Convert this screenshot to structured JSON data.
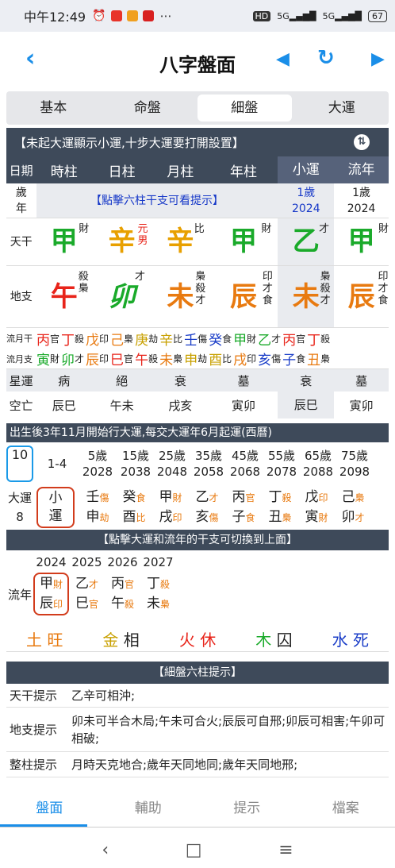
{
  "status": {
    "time": "中午12:49",
    "battery": "67",
    "signal1": "5G",
    "signal2": "5G",
    "hd": "HD"
  },
  "appbar": {
    "title": "八字盤面",
    "back": "‹",
    "prev": "◀",
    "refresh": "↻",
    "next": "▶"
  },
  "tabs": [
    "基本",
    "命盤",
    "細盤",
    "大運"
  ],
  "active_tab": "細盤",
  "header_note": "【未起大運顯示小運,十步大運要打開設置】",
  "columns": [
    "日期",
    "時柱",
    "日柱",
    "月柱",
    "年柱",
    "小運",
    "流年"
  ],
  "age_row": {
    "label": "歲年",
    "hint": "【點擊六柱干支可看提示】",
    "xiaoyun_age": "1歲",
    "xiaoyun_year": "2024",
    "liunian_age": "1歲",
    "liunian_year": "2024"
  },
  "stems": {
    "label": "天干",
    "items": [
      {
        "char": "甲",
        "god": "財"
      },
      {
        "char": "辛",
        "god": "元男"
      },
      {
        "char": "辛",
        "god": "比"
      },
      {
        "char": "甲",
        "god": "財"
      },
      {
        "char": "乙",
        "god": "才"
      },
      {
        "char": "甲",
        "god": "財"
      }
    ]
  },
  "branches": {
    "label": "地支",
    "items": [
      {
        "char": "午",
        "god": "殺梟"
      },
      {
        "char": "卯",
        "god": "才"
      },
      {
        "char": "未",
        "god": "梟殺才"
      },
      {
        "char": "辰",
        "god": "印才食"
      },
      {
        "char": "未",
        "god": "梟殺才"
      },
      {
        "char": "辰",
        "god": "印才食"
      }
    ]
  },
  "liu_stems": {
    "label": "流月干",
    "text": [
      [
        "丙",
        "官"
      ],
      [
        "丁",
        "殺"
      ],
      [
        "戊",
        "印"
      ],
      [
        "己",
        "梟"
      ],
      [
        "庚",
        "劫"
      ],
      [
        "辛",
        "比"
      ],
      [
        "壬",
        "傷"
      ],
      [
        "癸",
        "食"
      ],
      [
        "甲",
        "財"
      ],
      [
        "乙",
        "才"
      ],
      [
        "丙",
        "官"
      ],
      [
        "丁",
        "殺"
      ]
    ]
  },
  "liu_branches": {
    "label": "流月支",
    "text": [
      [
        "寅",
        "財"
      ],
      [
        "卯",
        "才"
      ],
      [
        "辰",
        "印"
      ],
      [
        "巳",
        "官"
      ],
      [
        "午",
        "殺"
      ],
      [
        "未",
        "梟"
      ],
      [
        "申",
        "劫"
      ],
      [
        "酉",
        "比"
      ],
      [
        "戌",
        "印"
      ],
      [
        "亥",
        "傷"
      ],
      [
        "子",
        "食"
      ],
      [
        "丑",
        "梟"
      ]
    ]
  },
  "xingyun": {
    "label": "星運",
    "values": [
      "病",
      "絕",
      "衰",
      "墓",
      "衰",
      "墓"
    ]
  },
  "kongwang": {
    "label": "空亡",
    "values": [
      "辰巳",
      "午未",
      "戌亥",
      "寅卯",
      "辰巳",
      "寅卯"
    ]
  },
  "dayun_note": "出生後3年11月開始行大運,每交大運年6月起運(西曆)",
  "dayun_ages": [
    {
      "age": "10",
      "year": ""
    },
    {
      "age": "1-4",
      "year": ""
    },
    {
      "age": "5歲",
      "year": "2028"
    },
    {
      "age": "15歲",
      "year": "2038"
    },
    {
      "age": "25歲",
      "year": "2048"
    },
    {
      "age": "35歲",
      "year": "2058"
    },
    {
      "age": "45歲",
      "year": "2068"
    },
    {
      "age": "55歲",
      "year": "2078"
    },
    {
      "age": "65歲",
      "year": "2088"
    },
    {
      "age": "75歲",
      "year": "2098"
    }
  ],
  "dayun_label": "大運",
  "dayun_num": "8",
  "dayun_small": "小運",
  "dayun_pillars": [
    {
      "s": "壬",
      "sg": "傷",
      "b": "申",
      "bg": "劫"
    },
    {
      "s": "癸",
      "sg": "食",
      "b": "酉",
      "bg": "比"
    },
    {
      "s": "甲",
      "sg": "財",
      "b": "戌",
      "bg": "印"
    },
    {
      "s": "乙",
      "sg": "才",
      "b": "亥",
      "bg": "傷"
    },
    {
      "s": "丙",
      "sg": "官",
      "b": "子",
      "bg": "食"
    },
    {
      "s": "丁",
      "sg": "殺",
      "b": "丑",
      "bg": "梟"
    },
    {
      "s": "戊",
      "sg": "印",
      "b": "寅",
      "bg": "財"
    },
    {
      "s": "己",
      "sg": "梟",
      "b": "卯",
      "bg": "才"
    }
  ],
  "switch_note": "【點擊大運和流年的干支可切換到上面】",
  "ln_years": [
    "2024",
    "2025",
    "2026",
    "2027"
  ],
  "ln_label": "流年",
  "ln_pillars": [
    {
      "s": "甲",
      "sg": "財",
      "b": "辰",
      "bg": "印"
    },
    {
      "s": "乙",
      "sg": "才",
      "b": "巳",
      "bg": "官"
    },
    {
      "s": "丙",
      "sg": "官",
      "b": "午",
      "bg": "殺"
    },
    {
      "s": "丁",
      "sg": "殺",
      "b": "未",
      "bg": "梟"
    }
  ],
  "wuxing": [
    {
      "el": "土",
      "st": "旺"
    },
    {
      "el": "金",
      "st": "相"
    },
    {
      "el": "火",
      "st": "休"
    },
    {
      "el": "木",
      "st": "囚"
    },
    {
      "el": "水",
      "st": "死"
    }
  ],
  "tips_title": "【細盤六柱提示】",
  "tips": [
    {
      "k": "天干提示",
      "v": "乙辛可相沖;"
    },
    {
      "k": "地支提示",
      "v": "卯未可半合木局;午未可合火;辰辰可自邢;卯辰可相害;午卯可相破;"
    },
    {
      "k": "整柱提示",
      "v": "月時天克地合;歲年天同地同;歲年天同地邢;"
    }
  ],
  "bottom_nav": [
    "盤面",
    "輔助",
    "提示",
    "檔案"
  ],
  "sys": [
    "‹",
    "□",
    "≡"
  ]
}
